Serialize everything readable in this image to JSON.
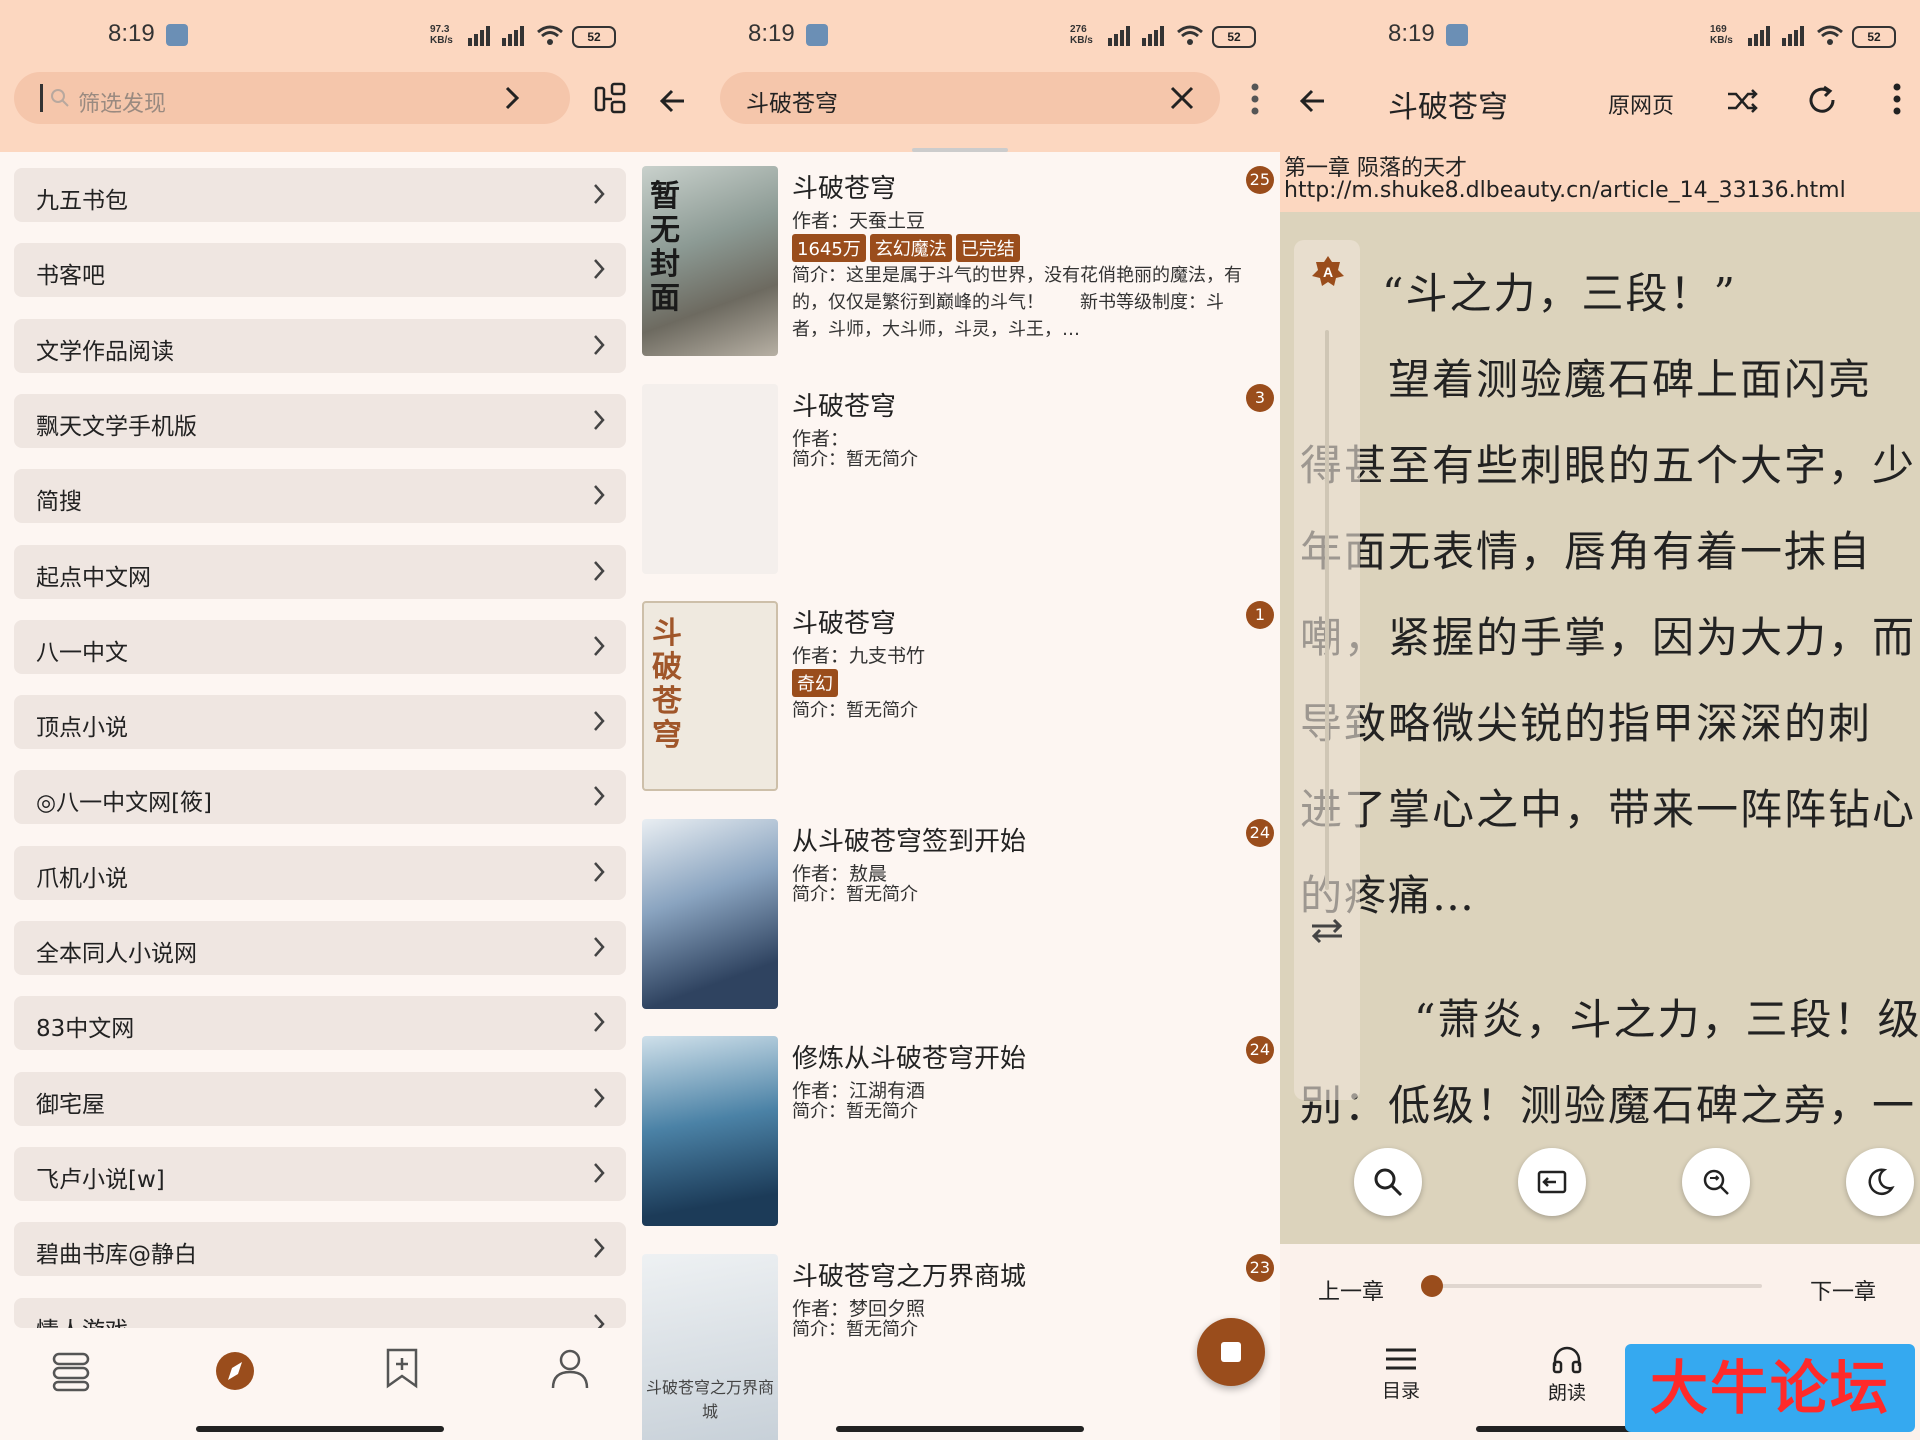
{
  "status": {
    "time": "8:19",
    "battery": "52",
    "speeds": [
      "97.3 KB/s",
      "276 KB/s",
      "169 KB/s"
    ]
  },
  "panel1": {
    "search_placeholder": "筛选发现",
    "sources": [
      "九五书包",
      "书客吧",
      "文学作品阅读",
      "飘天文学手机版",
      "简搜",
      "起点中文网",
      "八一中文",
      "顶点小说",
      "◎八一中文网[筱]",
      "爪机小说",
      "全本同人小说网",
      "83中文网",
      "御宅屋",
      "飞卢小说[w]",
      "碧曲书库@静白",
      "情人游戏"
    ],
    "nav": [
      "bookshelf-icon",
      "explore-icon",
      "bookmark-icon",
      "profile-icon"
    ]
  },
  "panel2": {
    "query": "斗破苍穹",
    "books": [
      {
        "title": "斗破苍穹",
        "author": "作者：天蚕土豆",
        "tags": [
          "1645万",
          "玄幻魔法",
          "已完结"
        ],
        "intro": "简介：这里是属于斗气的世界，没有花俏艳丽的魔法，有的，仅仅是繁衍到巅峰的斗气！　　新书等级制度：斗者，斗师，大斗师，斗灵，斗王，…",
        "count": "25",
        "cover_text": "暂无封面"
      },
      {
        "title": "斗破苍穹",
        "author": "作者：",
        "tags": [],
        "intro": "简介：暂无简介",
        "count": "3",
        "cover_text": ""
      },
      {
        "title": "斗破苍穹",
        "author": "作者：九支书竹",
        "tags": [
          "奇幻"
        ],
        "intro": "简介：暂无简介",
        "count": "1",
        "cover_text": "斗破苍穹"
      },
      {
        "title": "从斗破苍穹签到开始",
        "author": "作者：敖晨",
        "tags": [],
        "intro": "简介：暂无简介",
        "count": "24",
        "cover_text": ""
      },
      {
        "title": "修炼从斗破苍穹开始",
        "author": "作者：江湖有酒",
        "tags": [],
        "intro": "简介：暂无简介",
        "count": "24",
        "cover_text": ""
      },
      {
        "title": "斗破苍穹之万界商城",
        "author": "作者：梦回夕照",
        "tags": [],
        "intro": "简介：暂无简介",
        "count": "23",
        "cover_text": "斗破苍穹之万界商城"
      }
    ]
  },
  "panel3": {
    "title": "斗破苍穹",
    "source_page": "原网页",
    "chapter": "第一章 陨落的天才",
    "url": "http://m.shuke8.dlbeauty.cn/article_14_33136.html",
    "lines": [
      "“斗之力，三段！”",
      "　　望着测验魔石碑上面闪亮",
      "得甚至有些刺眼的五个大字，少",
      "年面无表情，唇角有着一抹自",
      "嘲，紧握的手掌，因为大力，而",
      "导致略微尖锐的指甲深深的刺",
      "进了掌心之中，带来一阵阵钻心",
      "的疼痛…",
      "　“萧炎，斗之力，三段！级",
      "别：低级！测验魔石碑之旁，一"
    ],
    "prev": "上一章",
    "next": "下一章",
    "bottom_labels": [
      "目录",
      "朗读"
    ],
    "progress": 0.0
  },
  "watermark": "大牛论坛",
  "colors": {
    "accent": "#9a4d1c",
    "topbar": "#fcd7c0",
    "reader_bg": "#dcd3bc"
  }
}
